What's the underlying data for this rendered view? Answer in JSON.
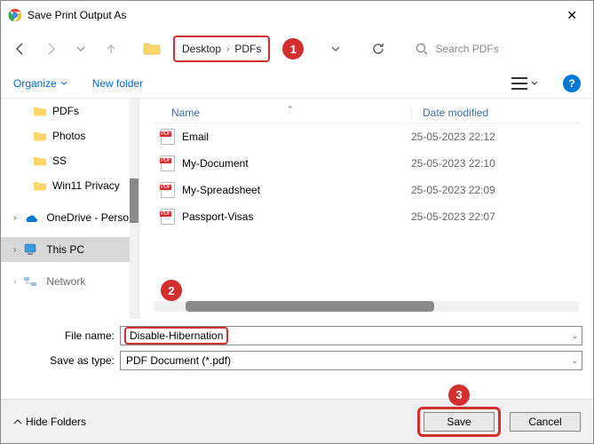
{
  "window": {
    "title": "Save Print Output As"
  },
  "breadcrumbs": {
    "part1": "Desktop",
    "part2": "PDFs"
  },
  "callouts": {
    "one": "1",
    "two": "2",
    "three": "3"
  },
  "search": {
    "placeholder": "Search PDFs"
  },
  "toolbar": {
    "organize": "Organize",
    "newfolder": "New folder"
  },
  "columns": {
    "name": "Name",
    "date": "Date modified"
  },
  "sidebar": {
    "items": [
      {
        "label": "PDFs"
      },
      {
        "label": "Photos"
      },
      {
        "label": "SS"
      },
      {
        "label": "Win11 Privacy"
      },
      {
        "label": "OneDrive - Perso"
      },
      {
        "label": "This PC"
      },
      {
        "label": "Network"
      }
    ]
  },
  "files": [
    {
      "name": "Email",
      "date": "25-05-2023 22:12"
    },
    {
      "name": "My-Document",
      "date": "25-05-2023 22:10"
    },
    {
      "name": "My-Spreadsheet",
      "date": "25-05-2023 22:09"
    },
    {
      "name": "Passport-Visas",
      "date": "25-05-2023 22:07"
    }
  ],
  "form": {
    "filename_label": "File name:",
    "filename_value": "Disable-Hibernation",
    "type_label": "Save as type:",
    "type_value": "PDF Document (*.pdf)"
  },
  "footer": {
    "hide": "Hide Folders",
    "save": "Save",
    "cancel": "Cancel"
  }
}
